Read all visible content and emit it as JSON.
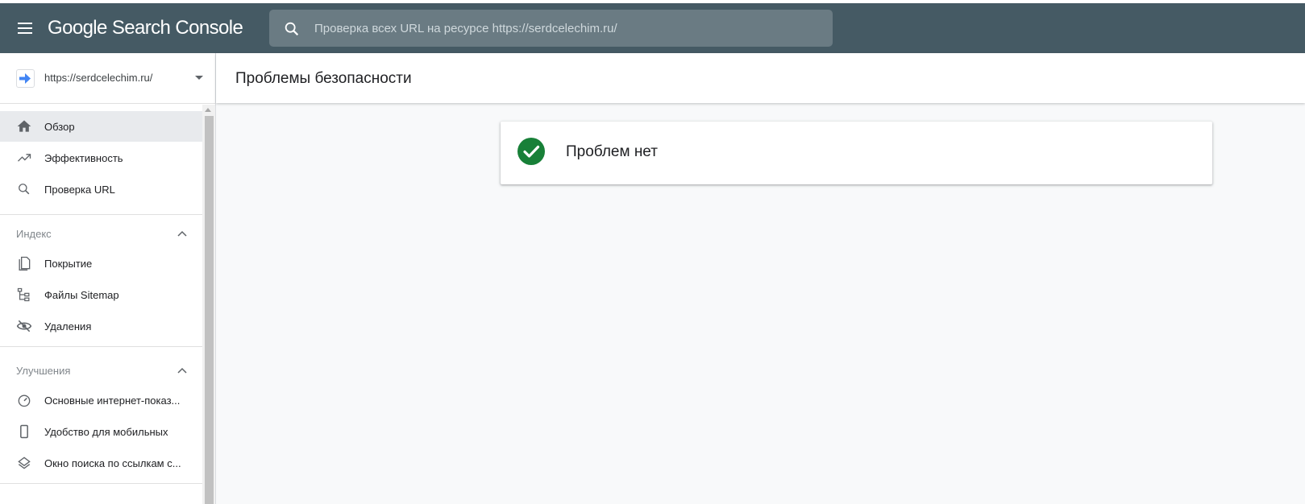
{
  "app": {
    "brand": "Google Search Console"
  },
  "search": {
    "placeholder": "Проверка всех URL на ресурсе https://serdcelechim.ru/"
  },
  "property": {
    "url": "https://serdcelechim.ru/"
  },
  "sidebar": {
    "items": [
      {
        "label": "Обзор",
        "icon": "home-icon"
      },
      {
        "label": "Эффективность",
        "icon": "trending-up-icon"
      },
      {
        "label": "Проверка URL",
        "icon": "search-icon"
      }
    ],
    "sections": [
      {
        "title": "Индекс",
        "items": [
          {
            "label": "Покрытие",
            "icon": "coverage-icon"
          },
          {
            "label": "Файлы Sitemap",
            "icon": "sitemap-icon"
          },
          {
            "label": "Удаления",
            "icon": "removals-icon"
          }
        ]
      },
      {
        "title": "Улучшения",
        "items": [
          {
            "label": "Основные интернет-показ...",
            "icon": "speed-icon"
          },
          {
            "label": "Удобство для мобильных",
            "icon": "mobile-icon"
          },
          {
            "label": "Окно поиска по ссылкам с...",
            "icon": "layers-icon"
          }
        ]
      }
    ]
  },
  "main": {
    "title": "Проблемы безопасности",
    "status": "Проблем нет"
  },
  "colors": {
    "topbar": "#455a64",
    "accent_green": "#188038",
    "property_arrow": "#4285f4"
  }
}
